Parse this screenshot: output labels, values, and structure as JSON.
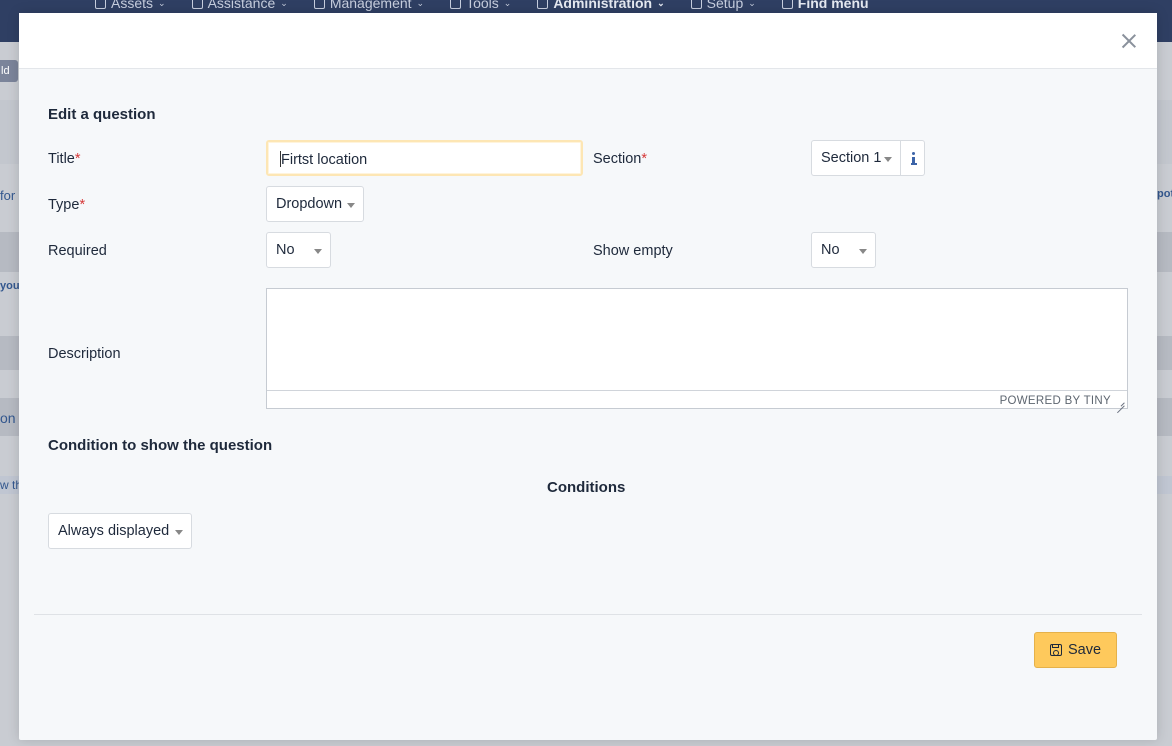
{
  "background": {
    "menu": [
      {
        "label": "Assets",
        "icon": "cube-icon"
      },
      {
        "label": "Assistance",
        "icon": "headset-icon"
      },
      {
        "label": "Management",
        "icon": "wallet-icon"
      },
      {
        "label": "Tools",
        "icon": "briefcase-icon"
      },
      {
        "label": "Administration",
        "icon": "shield-check-icon"
      },
      {
        "label": "Setup",
        "icon": "gear-icon"
      },
      {
        "label": "Find menu",
        "icon": "arrow-right-icon"
      }
    ],
    "tag": "ld",
    "fragments": [
      "for",
      "you",
      "on",
      "w th",
      "pot"
    ]
  },
  "modal": {
    "heading": "Edit a question",
    "fields": {
      "title": {
        "label": "Title",
        "required_mark": "*",
        "value": "Firtst location"
      },
      "section": {
        "label": "Section",
        "required_mark": "*",
        "value": "Section 1"
      },
      "type": {
        "label": "Type",
        "required_mark": "*",
        "value": "Dropdown"
      },
      "required": {
        "label": "Required",
        "value": "No"
      },
      "show_empty": {
        "label": "Show empty",
        "value": "No"
      },
      "description": {
        "label": "Description",
        "status": "POWERED BY TINY"
      }
    },
    "condition_heading": "Condition to show the question",
    "conditions_label": "Conditions",
    "conditions_select": "Always displayed",
    "save_label": "Save"
  },
  "colors": {
    "topbar": "#2f3f63",
    "required_mark": "#d63939",
    "save_button": "#fec95c",
    "info_icon": "#3c64a8"
  }
}
